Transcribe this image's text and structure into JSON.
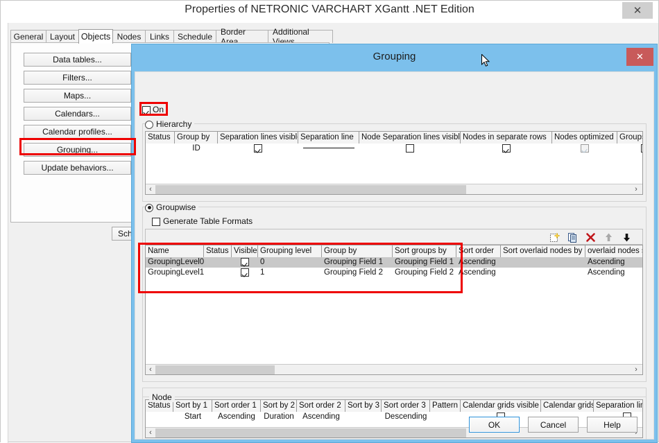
{
  "parent_window": {
    "title": "Properties of NETRONIC VARCHART XGantt .NET Edition",
    "close_label": "✕",
    "tabs": [
      {
        "label": "General",
        "active": false
      },
      {
        "label": "Layout",
        "active": false
      },
      {
        "label": "Objects",
        "active": true
      },
      {
        "label": "Nodes",
        "active": false
      },
      {
        "label": "Links",
        "active": false
      },
      {
        "label": "Schedule",
        "active": false
      },
      {
        "label": "Border Area",
        "active": false
      },
      {
        "label": "Additional Views",
        "active": false
      }
    ],
    "side_buttons": [
      {
        "label": "Data tables...",
        "highlighted": false
      },
      {
        "label": "Filters...",
        "highlighted": false
      },
      {
        "label": "Maps...",
        "highlighted": false
      },
      {
        "label": "Calendars...",
        "highlighted": false
      },
      {
        "label": "Calendar profiles...",
        "highlighted": false
      },
      {
        "label": "Grouping...",
        "highlighted": true
      },
      {
        "label": "Update behaviors...",
        "highlighted": false
      }
    ],
    "obscured_button": "Sch"
  },
  "dialog": {
    "title": "Grouping",
    "close_label": "✕",
    "on_checkbox": {
      "label": "On",
      "checked": true
    },
    "hierarchy": {
      "label": "Hierarchy",
      "selected": false,
      "table": {
        "columns": [
          "Status",
          "Group by",
          "Separation lines visible",
          "Separation line",
          "Node Separation lines visible",
          "Nodes in separate rows",
          "Nodes optimized",
          "Groups collap"
        ],
        "rows": [
          {
            "Status": "",
            "Group by": "ID",
            "Separation lines visible": "checked",
            "Separation line": "line",
            "Node Separation lines visible": "unchecked",
            "Nodes in separate rows": "checked",
            "Nodes optimized": "checked-disabled",
            "Groups collap": "unchecked"
          }
        ]
      }
    },
    "groupwise": {
      "label": "Groupwise",
      "selected": true,
      "generate_table_formats": {
        "label": "Generate Table Formats",
        "checked": false
      },
      "toolbar": [
        {
          "name": "new-icon",
          "enabled": true
        },
        {
          "name": "copy-icon",
          "enabled": true
        },
        {
          "name": "delete-icon",
          "enabled": true
        },
        {
          "name": "move-up-icon",
          "enabled": false
        },
        {
          "name": "move-down-icon",
          "enabled": true
        }
      ],
      "table": {
        "columns": [
          "Name",
          "Status",
          "Visible",
          "Grouping level",
          "Group by",
          "Sort groups by",
          "Sort order",
          "Sort overlaid nodes by",
          "overlaid nodes sort order"
        ],
        "rows": [
          {
            "Name": "GroupingLevel0",
            "Status": "",
            "Visible": "checked",
            "Grouping level": "0",
            "Group by": "Grouping Field 1",
            "Sort groups by": "Grouping Field 1",
            "Sort order": "Ascending",
            "Sort overlaid nodes by": "",
            "overlaid nodes sort order": "Ascending",
            "selected": true
          },
          {
            "Name": "GroupingLevel1",
            "Status": "",
            "Visible": "checked",
            "Grouping level": "1",
            "Group by": "Grouping Field 2",
            "Sort groups by": "Grouping Field 2",
            "Sort order": "Ascending",
            "Sort overlaid nodes by": "",
            "overlaid nodes sort order": "Ascending",
            "selected": false
          }
        ]
      }
    },
    "node": {
      "label": "Node",
      "table": {
        "columns": [
          "Status",
          "Sort by 1",
          "Sort order 1",
          "Sort by 2",
          "Sort order 2",
          "Sort by 3",
          "Sort order 3",
          "Pattern",
          "Calendar grids visible",
          "Calendar grids",
          "Separation lines vis"
        ],
        "rows": [
          {
            "Status": "",
            "Sort by 1": "Start",
            "Sort order 1": "Ascending",
            "Sort by 2": "Duration",
            "Sort order 2": "Ascending",
            "Sort by 3": "",
            "Sort order 3": "Descending",
            "Pattern": "",
            "Calendar grids visible": "unchecked",
            "Calendar grids": "",
            "Separation lines vis": "unchecked"
          }
        ]
      }
    },
    "buttons": [
      {
        "label": "OK",
        "focused": true
      },
      {
        "label": "Cancel",
        "focused": false
      },
      {
        "label": "Help",
        "focused": false
      }
    ],
    "scroll_arrows": {
      "left": "‹",
      "right": "›"
    }
  },
  "colors": {
    "dialog_title_bg": "#7cc0ec",
    "close_button_bg": "#c85a5a",
    "annotation": "#ee0000",
    "selected_row": "#c8c8c8",
    "focus_border": "#2a8fd8"
  }
}
